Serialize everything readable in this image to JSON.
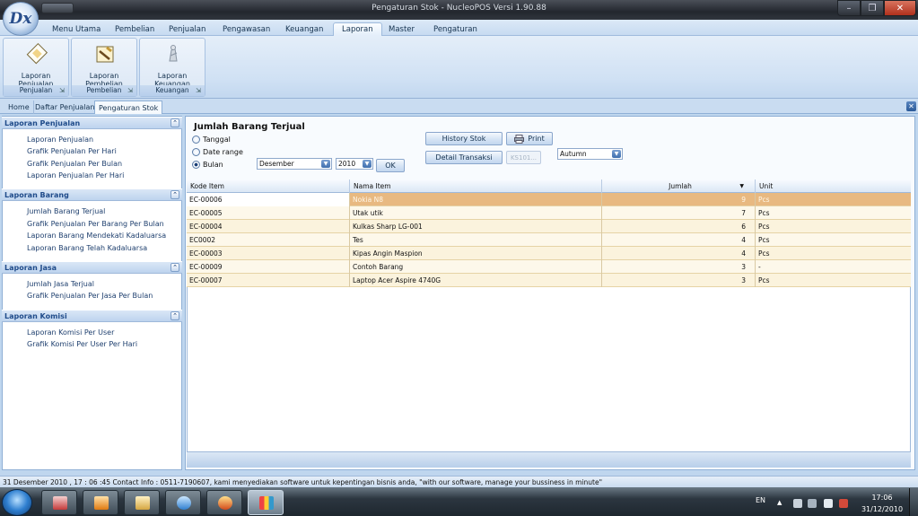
{
  "window": {
    "title": "Pengaturan Stok - NucleoPOS Versi 1.90.88",
    "logo_text": "Dx"
  },
  "menu": {
    "tabs": [
      "Menu Utama",
      "Pembelian",
      "Penjualan",
      "Pengawasan",
      "Keuangan",
      "Laporan",
      "Master",
      "Pengaturan"
    ],
    "active": "Laporan"
  },
  "ribbon": {
    "groups": [
      {
        "label": "Penjualan",
        "button": "Laporan Penjualan"
      },
      {
        "label": "Pembelian",
        "button": "Laporan Pembelian"
      },
      {
        "label": "Keuangan",
        "button": "Laporan Keuangan"
      }
    ]
  },
  "doc_tabs": [
    "Home",
    "Daftar Penjualan",
    "Pengaturan Stok"
  ],
  "sidebar": {
    "sections": [
      {
        "title": "Laporan Penjualan",
        "items": [
          "Laporan Penjualan",
          "Grafik Penjualan Per Hari",
          "Grafik Penjualan Per Bulan",
          "Laporan Penjualan Per Hari"
        ]
      },
      {
        "title": "Laporan Barang",
        "items": [
          "Jumlah Barang Terjual",
          "Grafik Penjualan Per Barang Per Bulan",
          "Laporan Barang Mendekati Kadaluarsa",
          "Laporan Barang Telah Kadaluarsa"
        ]
      },
      {
        "title": "Laporan Jasa",
        "items": [
          "Jumlah Jasa Terjual",
          "Grafik Penjualan Per Jasa Per Bulan"
        ]
      },
      {
        "title": "Laporan Komisi",
        "items": [
          "Laporan Komisi Per User",
          "Grafik Komisi Per User Per Hari"
        ]
      }
    ]
  },
  "report": {
    "title": "Jumlah Barang Terjual",
    "options": [
      "Tanggal",
      "Date range",
      "Bulan"
    ],
    "selected_option": "Bulan",
    "month": "Desember",
    "year": "2010",
    "ok_label": "OK",
    "history_label": "History Stok",
    "detail_label": "Detail Transaksi",
    "print_label": "Print",
    "code_placeholder": "KS101...",
    "theme": "Autumn"
  },
  "grid": {
    "columns": [
      "Kode Item",
      "Nama Item",
      "Jumlah",
      "Unit"
    ],
    "sort_indicator": "▼",
    "rows": [
      {
        "kode": "EC-00006",
        "nama": "Nokia N8",
        "jumlah": "9",
        "unit": "Pcs"
      },
      {
        "kode": "EC-00005",
        "nama": "Utak utik",
        "jumlah": "7",
        "unit": "Pcs"
      },
      {
        "kode": "EC-00004",
        "nama": "Kulkas Sharp LG-001",
        "jumlah": "6",
        "unit": "Pcs"
      },
      {
        "kode": "EC0002",
        "nama": "Tes",
        "jumlah": "4",
        "unit": "Pcs"
      },
      {
        "kode": "EC-00003",
        "nama": "Kipas Angin Maspion",
        "jumlah": "4",
        "unit": "Pcs"
      },
      {
        "kode": "EC-00009",
        "nama": "Contoh Barang",
        "jumlah": "3",
        "unit": "-"
      },
      {
        "kode": "EC-00007",
        "nama": "Laptop Acer Aspire 4740G",
        "jumlah": "3",
        "unit": "Pcs"
      }
    ]
  },
  "status": {
    "text": "31 Desember 2010 , 17 : 06 :45  Contact Info : 0511-7190607, kami menyediakan software untuk kepentingan bisnis anda, \"with our software, manage your bussiness in minute\""
  },
  "taskbar": {
    "lang": "EN",
    "time": "17:06",
    "date": "31/12/2010"
  }
}
